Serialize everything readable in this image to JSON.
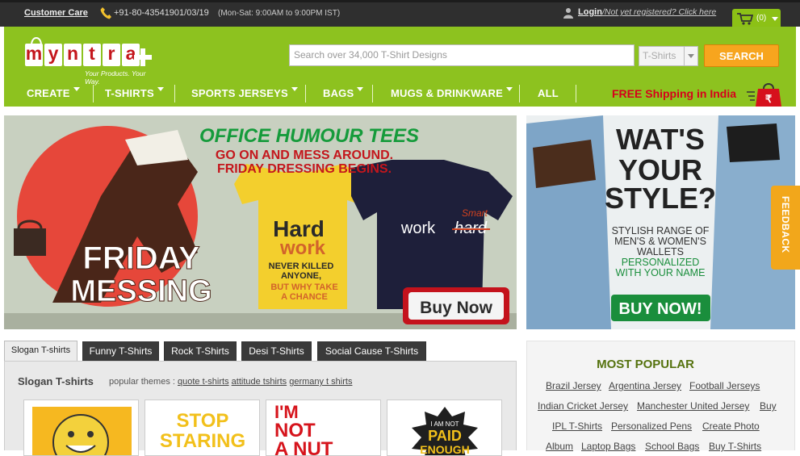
{
  "topbar": {
    "customer_care": "Customer Care",
    "phone": "+91-80-43541901/03/19",
    "hours": "(Mon-Sat: 9:00AM to 9:00PM IST)",
    "login": "Login",
    "register": "/Not yet registered? Click here",
    "cart_count": "(0)"
  },
  "logo": {
    "letters": [
      "m",
      "y",
      "n",
      "t",
      "r",
      "a"
    ],
    "tagline": "Your Products. Your Way."
  },
  "search": {
    "placeholder": "Search over 34,000 T-Shirt Designs",
    "category": "T-Shirts",
    "button": "SEARCH"
  },
  "nav": {
    "items": [
      "CREATE",
      "T-SHIRTS",
      "SPORTS JERSEYS",
      "BAGS",
      "MUGS & DRINKWARE",
      "ALL"
    ],
    "free_shipping": "FREE Shipping in India",
    "rupee": "₹"
  },
  "banner_main": {
    "heading": "OFFICE HUMOUR TEES",
    "sub1": "GO ON AND MESS AROUND.",
    "sub2": "FRIDAY DRESSING BEGINS.",
    "big1": "FRIDAY",
    "big2": "MESSING",
    "tee1_a": "Hard",
    "tee1_b": "work",
    "tee1_c": "NEVER KILLED",
    "tee1_d": "ANYONE,",
    "tee1_e": "BUT WHY TAKE",
    "tee1_f": "A CHANCE",
    "tee2_a": "work",
    "tee2_b": "hard",
    "tee2_c": "Smart",
    "buy": "Buy Now"
  },
  "banner_side": {
    "h1": "WAT'S",
    "h2": "YOUR",
    "h3": "STYLE?",
    "l1": "STYLISH RANGE OF",
    "l2": "MEN'S & WOMEN'S",
    "l3": "WALLETS",
    "l4": "PERSONALIZED",
    "l5": "WITH YOUR NAME",
    "buy": "BUY NOW!"
  },
  "feedback": "FEEDBACK",
  "tabs": [
    "Slogan T-shirts",
    "Funny T-Shirts",
    "Rock T-Shirts",
    "Desi T-Shirts",
    "Social Cause T-Shirts"
  ],
  "panel": {
    "title": "Slogan T-shirts",
    "themes_label": "popular themes :",
    "themes": [
      "quote t-shirts",
      "attitude tshirts",
      "germany t shirts"
    ],
    "thumbs": [
      {
        "text": ""
      },
      {
        "text1": "STOP",
        "text2": "STARING"
      },
      {
        "text1": "I'M",
        "text2": "NOT",
        "text3": "A NUT"
      },
      {
        "text1": "I AM NOT",
        "text2": "PAID",
        "text3": "ENOUGH"
      }
    ]
  },
  "most_popular": {
    "title": "MOST POPULAR",
    "rows": [
      [
        "Brazil Jersey",
        "Argentina Jersey",
        "Football Jerseys"
      ],
      [
        "Indian Cricket Jersey",
        "Manchester United Jersey",
        "Buy"
      ],
      [
        "IPL T-Shirts",
        "Personalized Pens",
        "Create Photo"
      ],
      [
        "Album",
        "Laptop Bags",
        "School Bags",
        "Buy T-Shirts"
      ]
    ]
  }
}
